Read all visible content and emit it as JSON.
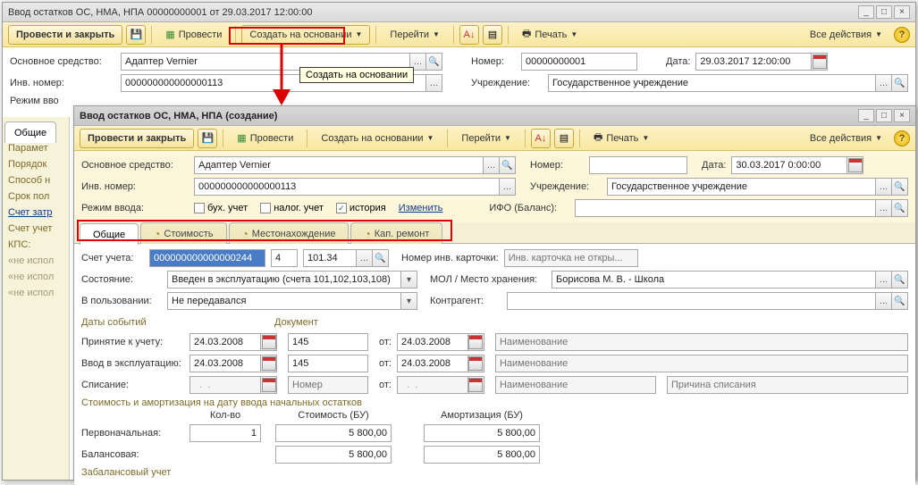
{
  "win1": {
    "title": "Ввод остатков ОС, НМА, НПА 00000000001 от 29.03.2017 12:00:00",
    "toolbar": {
      "post_close": "Провести и закрыть",
      "post": "Провести",
      "create_based": "Создать на основании",
      "goto": "Перейти",
      "print": "Печать",
      "all_actions": "Все действия"
    },
    "labels": {
      "main_asset": "Основное средство:",
      "inv_number": "Инв. номер:",
      "mode": "Режим вво",
      "number": "Номер:",
      "date": "Дата:",
      "org": "Учреждение:"
    },
    "values": {
      "main_asset": "Адаптер Vernier",
      "inv_number": "000000000000000113",
      "number": "00000000001",
      "date": "29.03.2017 12:00:00",
      "org": "Государственное учреждение"
    },
    "tooltip": "Создать на основании",
    "tabs": [
      "Общие"
    ],
    "sidebar": [
      "Парамет",
      "Порядок",
      "Способ н",
      "Срок пол",
      "Счет затр",
      "Счет учет",
      "КПС:",
      "«не испол",
      "«не испол",
      "«не испол"
    ]
  },
  "win2": {
    "title": "Ввод остатков ОС, НМА, НПА (создание)",
    "toolbar": {
      "post_close": "Провести и закрыть",
      "post": "Провести",
      "create_based": "Создать на основании",
      "goto": "Перейти",
      "print": "Печать",
      "all_actions": "Все действия"
    },
    "labels": {
      "main_asset": "Основное средство:",
      "inv_number": "Инв. номер:",
      "mode": "Режим ввода:",
      "number": "Номер:",
      "date": "Дата:",
      "org": "Учреждение:",
      "ifo": "ИФО (Баланс):",
      "change": "Изменить",
      "account": "Счет учета:",
      "card_num": "Номер инв. карточки:",
      "card_ph": "Инв. карточка не откры...",
      "state": "Состояние:",
      "mol": "МОЛ / Место хранения:",
      "in_use": "В пользовании:",
      "contragent": "Контрагент:",
      "dates_hdr": "Даты событий",
      "doc_hdr": "Документ",
      "accept": "Принятие к учету:",
      "commission": "Ввод в эксплуатацию:",
      "writeoff": "Списание:",
      "from": "от:",
      "name_ph": "Наименование",
      "num_ph": "Номер",
      "reason_ph": "Причина списания",
      "amort_hdr": "Стоимость и амортизация на дату ввода начальных остатков",
      "qty": "Кол-во",
      "cost_bu": "Стоимость (БУ)",
      "amort_bu": "Амортизация (БУ)",
      "initial": "Первоначальная:",
      "balance": "Балансовая:",
      "offbalance": "Забалансовый учет"
    },
    "checks": {
      "buh": "бух. учет",
      "nal": "налог. учет",
      "hist": "история"
    },
    "tabs": [
      "Общие",
      "Стоимость",
      "Местонахождение",
      "Кап. ремонт"
    ],
    "values": {
      "main_asset": "Адаптер Vernier",
      "inv_number": "000000000000000113",
      "number": "",
      "date": "30.03.2017 0:00:00",
      "org": "Государственное учреждение",
      "ifo": "",
      "acc1": "000000000000000244",
      "acc2": "4",
      "acc3": "101.34",
      "state": "Введен в эксплуатацию (счета 101,102,103,108)",
      "mol": "Борисова М. В. - Школа",
      "in_use": "Не передавался",
      "accept_date": "24.03.2008",
      "accept_num": "145",
      "accept_from": "24.03.2008",
      "comm_date": "24.03.2008",
      "comm_num": "145",
      "comm_from": "24.03.2008",
      "writeoff_date": "  .  .    ",
      "writeoff_from": "  .  .    ",
      "qty1": "1",
      "cost1": "5 800,00",
      "amort1": "5 800,00",
      "cost2": "5 800,00",
      "amort2": "5 800,00"
    }
  }
}
